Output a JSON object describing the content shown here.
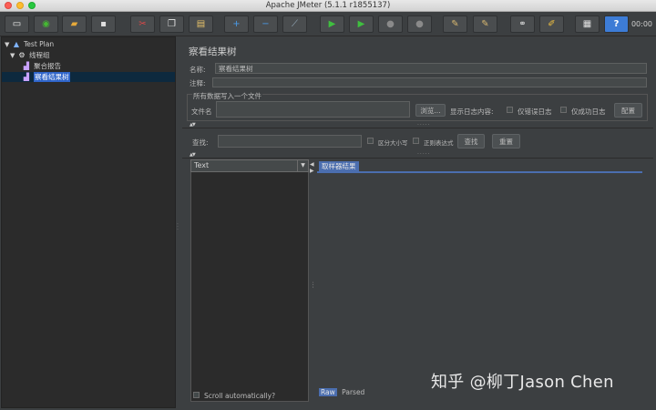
{
  "window": {
    "title": "Apache JMeter (5.1.1 r1855137)"
  },
  "toolbar": {
    "buttons": [
      {
        "name": "new-icon",
        "glyph": "▭",
        "color": "#f2f2f2"
      },
      {
        "name": "templates-icon",
        "glyph": "◉",
        "color": "#45b832"
      },
      {
        "name": "open-icon",
        "glyph": "▰",
        "color": "#e6a93a"
      },
      {
        "name": "save-icon",
        "glyph": "▪",
        "color": "#e0e0e0"
      },
      {
        "name": "cut-icon",
        "glyph": "✂",
        "color": "#e04848"
      },
      {
        "name": "copy-icon",
        "glyph": "❐",
        "color": "#e8e8e8"
      },
      {
        "name": "paste-icon",
        "glyph": "▤",
        "color": "#e8c26a"
      },
      {
        "name": "expand-icon",
        "glyph": "+",
        "color": "#4a9be8"
      },
      {
        "name": "collapse-icon",
        "glyph": "−",
        "color": "#4a9be8"
      },
      {
        "name": "toggle-icon",
        "glyph": "⟋",
        "color": "#9ab0c0"
      },
      {
        "name": "start-icon",
        "glyph": "▶",
        "color": "#3fbf3f"
      },
      {
        "name": "start-no-pauses-icon",
        "glyph": "▶",
        "color": "#3fbf3f"
      },
      {
        "name": "stop-icon",
        "glyph": "●",
        "color": "#8a8a8a"
      },
      {
        "name": "shutdown-icon",
        "glyph": "●",
        "color": "#8a8a8a"
      },
      {
        "name": "clear-icon",
        "glyph": "✎",
        "color": "#d8b870"
      },
      {
        "name": "clear-all-icon",
        "glyph": "✎",
        "color": "#d8b870"
      },
      {
        "name": "search-icon",
        "glyph": "⚭",
        "color": "#d0d0d0"
      },
      {
        "name": "reset-search-icon",
        "glyph": "✐",
        "color": "#f0c040"
      },
      {
        "name": "function-helper-icon",
        "glyph": "▦",
        "color": "#e0e0e0"
      },
      {
        "name": "help-icon",
        "glyph": "?",
        "color": "#ffffff"
      }
    ],
    "timer": "00:00"
  },
  "tree": {
    "items": [
      {
        "label": "Test Plan",
        "twisty": "▼",
        "icon": "▲",
        "icon_color": "#7fb3ff"
      },
      {
        "label": "线程组",
        "twisty": "▼",
        "icon": "⚙",
        "icon_color": "#e6e6e6"
      },
      {
        "label": "聚合报告",
        "twisty": "",
        "icon": "▟",
        "icon_color": "#c9a2ff"
      },
      {
        "label": "察看结果树",
        "twisty": "",
        "icon": "▟",
        "icon_color": "#c9a2ff"
      }
    ]
  },
  "panel": {
    "title": "察看结果树",
    "name_label": "名称:",
    "name_value": "察看结果树",
    "comment_label": "注释:",
    "comment_value": "",
    "file_group_title": "所有数据写入一个文件",
    "filename_label": "文件名",
    "filename_value": "",
    "browse_label": "浏览...",
    "log_display_label": "显示日志内容:",
    "errors_only_label": "仅错误日志",
    "success_only_label": "仅成功日志",
    "configure_label": "配置",
    "search_label": "查找:",
    "search_value": "",
    "case_sensitive_label": "区分大小写",
    "regex_label": "正则表达式",
    "find_label": "查找",
    "reset_label": "重置",
    "renderer_selected": "Text",
    "sampler_result_tab": "取样器结果",
    "scroll_auto_label": "Scroll automatically?",
    "raw_tab": "Raw",
    "parsed_tab": "Parsed"
  },
  "watermark": "知乎 @柳丁Jason Chen"
}
